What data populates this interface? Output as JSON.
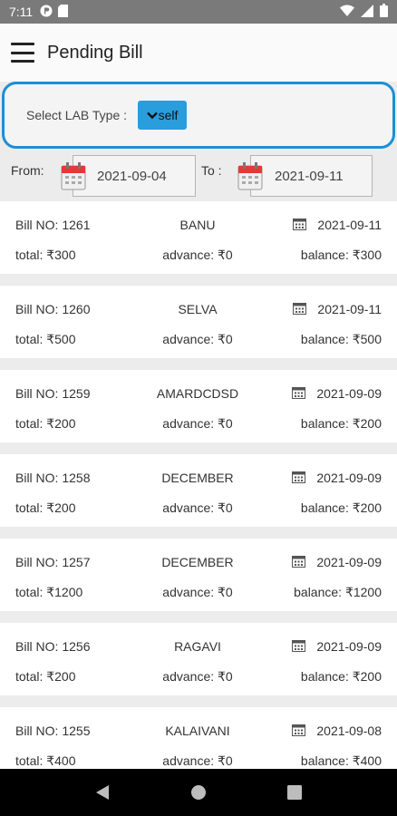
{
  "status_bar": {
    "time": "7:11"
  },
  "app_bar": {
    "title": "Pending Bill"
  },
  "filter": {
    "label": "Select LAB Type :",
    "selected": "self"
  },
  "date_range": {
    "from_label": "From:",
    "from_value": "2021-09-04",
    "to_label": "To :",
    "to_value": "2021-09-11"
  },
  "bills": [
    {
      "bill_no": "Bill NO: 1261",
      "name": "BANU",
      "date": "2021-09-11",
      "total": "total: ₹300",
      "advance": "advance: ₹0",
      "balance": "balance: ₹300"
    },
    {
      "bill_no": "Bill NO: 1260",
      "name": "SELVA",
      "date": "2021-09-11",
      "total": "total: ₹500",
      "advance": "advance: ₹0",
      "balance": "balance: ₹500"
    },
    {
      "bill_no": "Bill NO: 1259",
      "name": "AMARDCDSD",
      "date": "2021-09-09",
      "total": "total: ₹200",
      "advance": "advance: ₹0",
      "balance": "balance: ₹200"
    },
    {
      "bill_no": "Bill NO: 1258",
      "name": "DECEMBER",
      "date": "2021-09-09",
      "total": "total: ₹200",
      "advance": "advance: ₹0",
      "balance": "balance: ₹200"
    },
    {
      "bill_no": "Bill NO: 1257",
      "name": "DECEMBER",
      "date": "2021-09-09",
      "total": "total: ₹1200",
      "advance": "advance: ₹0",
      "balance": "balance: ₹1200"
    },
    {
      "bill_no": "Bill NO: 1256",
      "name": "RAGAVI",
      "date": "2021-09-09",
      "total": "total: ₹200",
      "advance": "advance: ₹0",
      "balance": "balance: ₹200"
    },
    {
      "bill_no": "Bill NO: 1255",
      "name": "KALAIVANI",
      "date": "2021-09-08",
      "total": "total: ₹400",
      "advance": "advance: ₹0",
      "balance": "balance: ₹400"
    }
  ],
  "colors": {
    "accent": "#1c8fd6",
    "select_bg": "#2a9ddc",
    "calendar_red": "#e53935"
  }
}
